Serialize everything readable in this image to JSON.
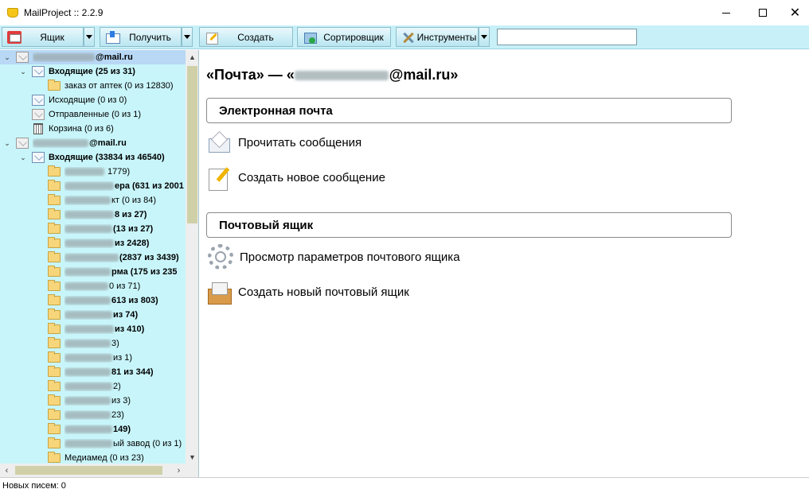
{
  "window": {
    "title": "MailProject :: 2.2.9",
    "minimize": "—",
    "close": "✕"
  },
  "toolbar": {
    "mailbox_label": "Ящик",
    "receive_label": "Получить",
    "create_label": "Создать",
    "sorter_label": "Сортировщик",
    "tools_label": "Инструменты",
    "search_value": ""
  },
  "tree": {
    "account1": {
      "email_suffix": "@mail.ru"
    },
    "inbox1": {
      "label": "Входящие (25 из 31)"
    },
    "inbox1_sub": {
      "label": "заказ от аптек (0 из 12830)"
    },
    "outbox": {
      "label": "Исходящие (0 из 0)"
    },
    "sent": {
      "label": "Отправленные (0 из 1)"
    },
    "trash": {
      "label": "Корзина (0 из 6)"
    },
    "account2": {
      "email_suffix": "@mail.ru"
    },
    "inbox2": {
      "label": "Входящие (33834 из 46540)"
    },
    "folders": [
      {
        "text": " 1779)",
        "bold": false
      },
      {
        "text": "ера (631 из 2001",
        "bold": true
      },
      {
        "text": "кт (0 из 84)",
        "bold": false
      },
      {
        "text": "8 из 27)",
        "bold": true
      },
      {
        "text": "(13 из 27)",
        "bold": true
      },
      {
        "text": "из 2428)",
        "bold": true
      },
      {
        "text": "(2837 из 3439)",
        "bold": true
      },
      {
        "text": "рма (175 из 235",
        "bold": true
      },
      {
        "text": "0 из 71)",
        "bold": false
      },
      {
        "text": "613 из 803)",
        "bold": true
      },
      {
        "text": "из 74)",
        "bold": true
      },
      {
        "text": "из 410)",
        "bold": true
      },
      {
        "text": "3)",
        "bold": false
      },
      {
        "text": "из 1)",
        "bold": false
      },
      {
        "text": "81 из 344)",
        "bold": true
      },
      {
        "text": "2)",
        "bold": false
      },
      {
        "text": "из 3)",
        "bold": false
      },
      {
        "text": "23)",
        "bold": false
      },
      {
        "text": "149)",
        "bold": true
      },
      {
        "text": "ый завод (0 из 1)",
        "bold": false
      },
      {
        "text": "Медиамед (0 из 23)",
        "bold": false
      }
    ]
  },
  "main": {
    "title_prefix": "«Почта» — «",
    "title_suffix": "@mail.ru»",
    "section_email": "Электронная почта",
    "read_messages": "Прочитать сообщения",
    "new_message": "Создать новое сообщение",
    "section_mailbox": "Почтовый ящик",
    "mailbox_settings": "Просмотр параметров почтового ящика",
    "new_mailbox": "Создать новый почтовый ящик"
  },
  "status": {
    "text": "Новых писем: 0"
  }
}
